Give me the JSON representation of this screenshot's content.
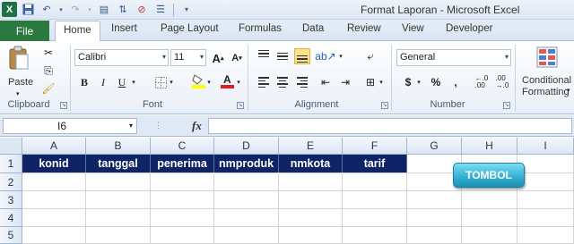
{
  "window": {
    "title": "Format Laporan  -  Microsoft Excel"
  },
  "tabs": [
    {
      "label": "File"
    },
    {
      "label": "Home"
    },
    {
      "label": "Insert"
    },
    {
      "label": "Page Layout"
    },
    {
      "label": "Formulas"
    },
    {
      "label": "Data"
    },
    {
      "label": "Review"
    },
    {
      "label": "View"
    },
    {
      "label": "Developer"
    }
  ],
  "ribbon": {
    "clipboard": {
      "paste_label": "Paste",
      "group_label": "Clipboard"
    },
    "font": {
      "name": "Calibri",
      "size": "11",
      "group_label": "Font"
    },
    "alignment": {
      "group_label": "Alignment"
    },
    "number": {
      "format": "General",
      "group_label": "Number",
      "currency_symbol": "$",
      "percent_symbol": "%",
      "comma_symbol": ","
    },
    "styles": {
      "cond_format_line1": "Conditional",
      "cond_format_line2": "Formatting"
    }
  },
  "formula_bar": {
    "cell_ref": "I6",
    "fx": "fx",
    "formula": ""
  },
  "sheet": {
    "columns": [
      "A",
      "B",
      "C",
      "D",
      "E",
      "F",
      "G",
      "H",
      "I"
    ],
    "rows": [
      "1",
      "2",
      "3",
      "4",
      "5"
    ],
    "header_row": [
      "konid",
      "tanggal",
      "penerima",
      "nmproduk",
      "nmkota",
      "tarif"
    ],
    "button_label": "TOMBOL"
  },
  "colors": {
    "header_fill": "#0f2466",
    "file_tab": "#2a7a3f",
    "button": "#34b3d6"
  }
}
